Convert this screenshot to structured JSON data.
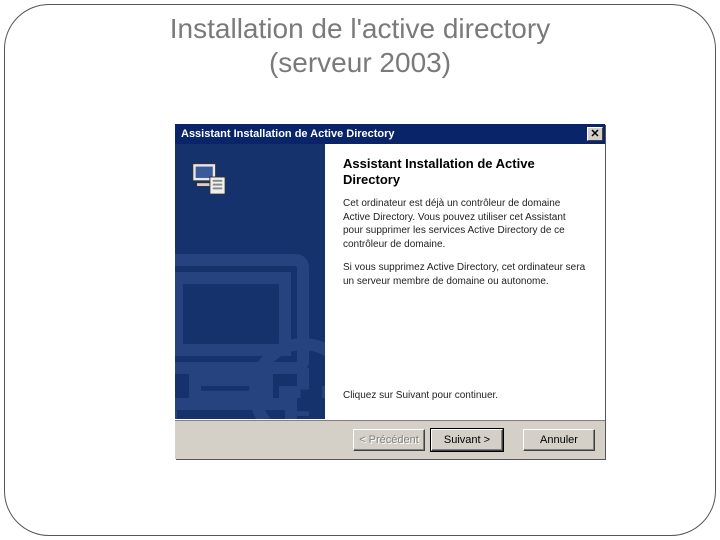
{
  "slide": {
    "title_line1": "Installation de l'active directory",
    "title_line2": "(serveur 2003)"
  },
  "window": {
    "title": "Assistant Installation de Active Directory",
    "close_glyph": "✕"
  },
  "wizard": {
    "heading": "Assistant Installation de Active Directory",
    "paragraph1": "Cet ordinateur est déjà un contrôleur de domaine Active Directory. Vous pouvez utiliser cet Assistant pour supprimer les services Active Directory de ce contrôleur de domaine.",
    "paragraph2": "Si vous supprimez Active Directory, cet ordinateur sera un serveur membre de domaine ou autonome.",
    "continue": "Cliquez sur Suivant pour continuer."
  },
  "buttons": {
    "back": "< Précédent",
    "next": "Suivant >",
    "cancel": "Annuler"
  }
}
